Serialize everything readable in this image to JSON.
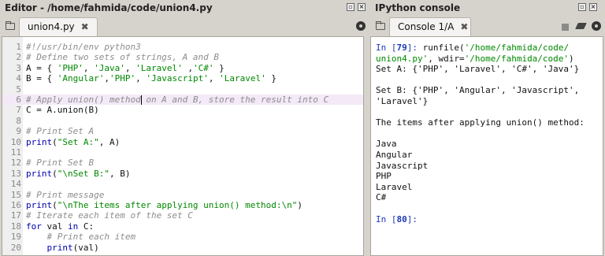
{
  "editor": {
    "pane_title": "Editor - /home/fahmida/code/union4.py",
    "tab_label": "union4.py",
    "tab_close": "✖",
    "lines": [
      {
        "n": "1",
        "segments": [
          {
            "t": "#!/usr/bin/env python3",
            "c": "com"
          }
        ]
      },
      {
        "n": "2",
        "segments": [
          {
            "t": "# Define two sets of strings, A and B",
            "c": "com"
          }
        ]
      },
      {
        "n": "3",
        "segments": [
          {
            "t": "A = { ",
            "c": "def"
          },
          {
            "t": "'PHP'",
            "c": "str"
          },
          {
            "t": ", ",
            "c": "def"
          },
          {
            "t": "'Java'",
            "c": "str"
          },
          {
            "t": ", ",
            "c": "def"
          },
          {
            "t": "'Laravel'",
            "c": "str"
          },
          {
            "t": " ,",
            "c": "def"
          },
          {
            "t": "'C#'",
            "c": "str"
          },
          {
            "t": " }",
            "c": "def"
          }
        ]
      },
      {
        "n": "4",
        "segments": [
          {
            "t": "B = { ",
            "c": "def"
          },
          {
            "t": "'Angular'",
            "c": "str"
          },
          {
            "t": ",",
            "c": "def"
          },
          {
            "t": "'PHP'",
            "c": "str"
          },
          {
            "t": ", ",
            "c": "def"
          },
          {
            "t": "'Javascript'",
            "c": "str"
          },
          {
            "t": ", ",
            "c": "def"
          },
          {
            "t": "'Laravel'",
            "c": "str"
          },
          {
            "t": " }",
            "c": "def"
          }
        ]
      },
      {
        "n": "5",
        "segments": []
      },
      {
        "n": "6",
        "segments": [
          {
            "t": "# Apply union() method on A and B, store the result into C",
            "c": "com"
          }
        ],
        "highlight": true
      },
      {
        "n": "7",
        "segments": [
          {
            "t": "C = A.union(B)",
            "c": "def"
          }
        ]
      },
      {
        "n": "8",
        "segments": []
      },
      {
        "n": "9",
        "segments": [
          {
            "t": "# Print Set A",
            "c": "com"
          }
        ]
      },
      {
        "n": "10",
        "segments": [
          {
            "t": "print",
            "c": "kw"
          },
          {
            "t": "(",
            "c": "def"
          },
          {
            "t": "\"Set A:\"",
            "c": "str"
          },
          {
            "t": ", A)",
            "c": "def"
          }
        ]
      },
      {
        "n": "11",
        "segments": []
      },
      {
        "n": "12",
        "segments": [
          {
            "t": "# Print Set B",
            "c": "com"
          }
        ]
      },
      {
        "n": "13",
        "segments": [
          {
            "t": "print",
            "c": "kw"
          },
          {
            "t": "(",
            "c": "def"
          },
          {
            "t": "\"\\nSet B:\"",
            "c": "str"
          },
          {
            "t": ", B)",
            "c": "def"
          }
        ]
      },
      {
        "n": "14",
        "segments": []
      },
      {
        "n": "15",
        "segments": [
          {
            "t": "# Print message",
            "c": "com"
          }
        ]
      },
      {
        "n": "16",
        "segments": [
          {
            "t": "print",
            "c": "kw"
          },
          {
            "t": "(",
            "c": "def"
          },
          {
            "t": "\"\\nThe items after applying union() method:\\n\"",
            "c": "str"
          },
          {
            "t": ")",
            "c": "def"
          }
        ]
      },
      {
        "n": "17",
        "segments": [
          {
            "t": "# Iterate each item of the set C",
            "c": "com"
          }
        ]
      },
      {
        "n": "18",
        "segments": [
          {
            "t": "for",
            "c": "kw"
          },
          {
            "t": " val ",
            "c": "def"
          },
          {
            "t": "in",
            "c": "kw"
          },
          {
            "t": " C:",
            "c": "def"
          }
        ]
      },
      {
        "n": "19",
        "segments": [
          {
            "t": "    # Print each item",
            "c": "com"
          }
        ]
      },
      {
        "n": "20",
        "segments": [
          {
            "t": "    ",
            "c": "def"
          },
          {
            "t": "print",
            "c": "kw"
          },
          {
            "t": "(val)",
            "c": "def"
          }
        ]
      }
    ]
  },
  "console": {
    "pane_title": "IPython console",
    "tab_label": "Console 1/A",
    "tab_close": "✖",
    "lines": [
      [
        {
          "t": "In [",
          "c": "prompt"
        },
        {
          "t": "79",
          "c": "num"
        },
        {
          "t": "]: ",
          "c": "prompt"
        },
        {
          "t": "runfile(",
          "c": "def"
        },
        {
          "t": "'/home/fahmida/code/",
          "c": "str"
        }
      ],
      [
        {
          "t": "union4.py'",
          "c": "str"
        },
        {
          "t": ", wdir=",
          "c": "def"
        },
        {
          "t": "'/home/fahmida/code'",
          "c": "str"
        },
        {
          "t": ")",
          "c": "def"
        }
      ],
      [
        {
          "t": "Set A: {'PHP', 'Laravel', 'C#', 'Java'}",
          "c": "def"
        }
      ],
      [],
      [
        {
          "t": "Set B: {'PHP', 'Angular', 'Javascript',",
          "c": "def"
        }
      ],
      [
        {
          "t": "'Laravel'}",
          "c": "def"
        }
      ],
      [],
      [
        {
          "t": "The items after applying union() method:",
          "c": "def"
        }
      ],
      [],
      [
        {
          "t": "Java",
          "c": "def"
        }
      ],
      [
        {
          "t": "Angular",
          "c": "def"
        }
      ],
      [
        {
          "t": "Javascript",
          "c": "def"
        }
      ],
      [
        {
          "t": "PHP",
          "c": "def"
        }
      ],
      [
        {
          "t": "Laravel",
          "c": "def"
        }
      ],
      [
        {
          "t": "C#",
          "c": "def"
        }
      ],
      [],
      [
        {
          "t": "In [",
          "c": "prompt"
        },
        {
          "t": "80",
          "c": "num"
        },
        {
          "t": "]:",
          "c": "prompt"
        }
      ]
    ]
  },
  "colors": {
    "comment": "#8c8c8c",
    "string": "#008800",
    "keyword": "#0000b0",
    "prompt": "#1c3ab8",
    "current_line": "#f3e9f7"
  },
  "icons": [
    "folder-icon",
    "gear-icon",
    "stop-icon",
    "eraser-icon",
    "undock-icon",
    "close-icon"
  ]
}
